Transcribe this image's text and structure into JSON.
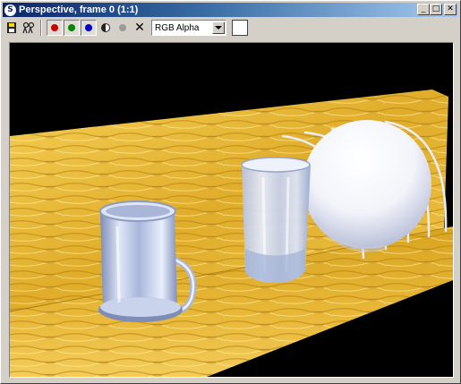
{
  "window": {
    "title": "Perspective, frame 0 (1:1)",
    "title_icon_glyph": "S",
    "minimize_glyph": "_",
    "maximize_glyph": "□",
    "close_glyph": "✕"
  },
  "toolbar": {
    "channel_select": {
      "value": "RGB Alpha"
    },
    "channels": [
      {
        "name": "red-channel",
        "color": "#cc0000",
        "active": true
      },
      {
        "name": "green-channel",
        "color": "#008800",
        "active": true
      },
      {
        "name": "blue-channel",
        "color": "#0000cc",
        "active": true
      }
    ],
    "clear_glyph": "✕",
    "swatch_color": "#ffffff"
  },
  "scene": {
    "objects": [
      "glass-mug",
      "tall-glass",
      "white-sphere",
      "wooden-floor",
      "wooden-wall",
      "wire-arcs"
    ],
    "colors": {
      "background": "#000000",
      "wood_light": "#f2c84a",
      "wood_mid": "#d9a520",
      "wood_dark": "#a87a10",
      "glass": "#b8c4e0",
      "sphere": "#ffffff"
    }
  }
}
